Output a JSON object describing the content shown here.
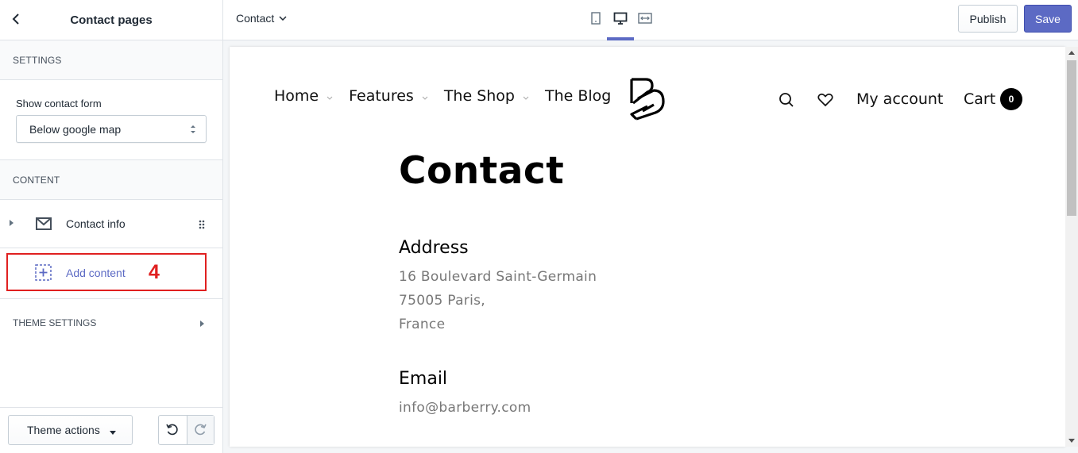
{
  "sidebar": {
    "title": "Contact pages",
    "settings_label": "SETTINGS",
    "show_contact_form_label": "Show contact form",
    "show_contact_form_value": "Below google map",
    "content_label": "CONTENT",
    "contact_info_label": "Contact info",
    "add_content_label": "Add content",
    "annotation_number": "4",
    "theme_settings_label": "THEME SETTINGS",
    "theme_actions_label": "Theme actions"
  },
  "topbar": {
    "page_selector": "Contact",
    "publish_label": "Publish",
    "save_label": "Save",
    "active_device": "desktop"
  },
  "preview": {
    "nav": [
      "Home",
      "Features",
      "The Shop",
      "The Blog"
    ],
    "account_label": "My account",
    "cart_label": "Cart",
    "cart_count": "0",
    "page_title": "Contact",
    "address_heading": "Address",
    "address_lines": [
      "16 Boulevard Saint-Germain",
      "75005 Paris,",
      "France"
    ],
    "email_heading": "Email",
    "email_value": "info@barberry.com"
  },
  "colors": {
    "accent": "#5c6ac4",
    "annotation": "#e02020"
  }
}
